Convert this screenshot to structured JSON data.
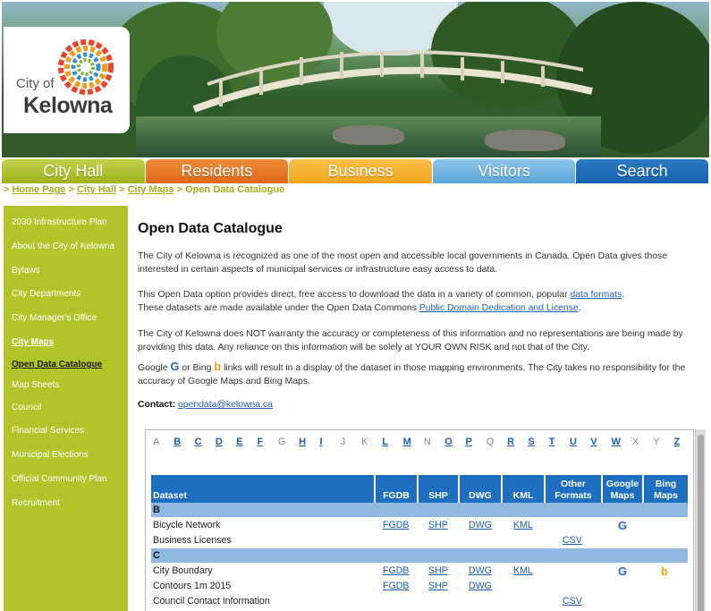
{
  "logo": {
    "line1": "City of",
    "line2": "Kelowna"
  },
  "nav": [
    "City Hall",
    "Residents",
    "Business",
    "Visitors",
    "Search"
  ],
  "breadcrumb": {
    "prefix": ">",
    "home": "Home Page",
    "city_hall": "City Hall",
    "city_maps": "City Maps",
    "current": "Open Data Catalogue",
    "sep": ">"
  },
  "sidebar": [
    "2030 Infrastructure Plan",
    "About the City of Kelowna",
    "Bylaws",
    "City Departments",
    "City Manager's Office",
    "City Maps",
    "Open Data Catalogue",
    "Map Sheets",
    "Council",
    "Financial Services",
    "Municipal Elections",
    "Official Community Plan",
    "Recruitment"
  ],
  "page": {
    "title": "Open Data Catalogue",
    "p1": "The City of Kelowna is recognized as one of the most open and accessible local governments in Canada. Open Data gives those interested in certain aspects of municipal services or infrastructure easy access to data.",
    "p2a": "This Open Data option provides direct, free access to download the data in a variety of common, popular",
    "p2_link1": "data formats",
    "p2b": "These datasets are made available under the Open Data Commons",
    "p2_link2": "Public Domain Dedication and License",
    "p3": "The City of Kelowna does NOT warranty the accuracy or completeness of this information and no representations are being made by providing this data. Any reliance on this information will be solely at YOUR OWN RISK and not that of the City.",
    "p4a": "Google",
    "p4b": "or Bing",
    "p4c": "links will result in a display of the dataset in those mapping environments. The City takes no responsibility for the accuracy of Google Maps and Bing Maps.",
    "contact_label": "Contact:",
    "contact_email": "opendata@kelowna.ca"
  },
  "alphabet": [
    {
      "l": "A",
      "link": false
    },
    {
      "l": "B",
      "link": true
    },
    {
      "l": "C",
      "link": true
    },
    {
      "l": "D",
      "link": true
    },
    {
      "l": "E",
      "link": true
    },
    {
      "l": "F",
      "link": true
    },
    {
      "l": "G",
      "link": false
    },
    {
      "l": "H",
      "link": true
    },
    {
      "l": "I",
      "link": true
    },
    {
      "l": "J",
      "link": false
    },
    {
      "l": "K",
      "link": false
    },
    {
      "l": "L",
      "link": true
    },
    {
      "l": "M",
      "link": true
    },
    {
      "l": "N",
      "link": false
    },
    {
      "l": "O",
      "link": true
    },
    {
      "l": "P",
      "link": true
    },
    {
      "l": "Q",
      "link": false
    },
    {
      "l": "R",
      "link": true
    },
    {
      "l": "S",
      "link": true
    },
    {
      "l": "T",
      "link": true
    },
    {
      "l": "U",
      "link": true
    },
    {
      "l": "V",
      "link": true
    },
    {
      "l": "W",
      "link": true
    },
    {
      "l": "X",
      "link": false
    },
    {
      "l": "Y",
      "link": false
    },
    {
      "l": "Z",
      "link": true
    }
  ],
  "table": {
    "headers": {
      "dataset": "Dataset",
      "fgdb": "FGDB",
      "shp": "SHP",
      "dwg": "DWG",
      "kml": "KML",
      "other1": "Other",
      "other2": "Formats",
      "google1": "Google",
      "google2": "Maps",
      "bing1": "Bing",
      "bing2": "Maps"
    },
    "groups": [
      {
        "letter": "B",
        "rows": [
          {
            "name": "Bicycle Network",
            "fgdb": "FGDB",
            "shp": "SHP",
            "dwg": "DWG",
            "kml": "KML",
            "other": "",
            "google": true,
            "bing": false
          },
          {
            "name": "Business Licenses",
            "fgdb": "",
            "shp": "",
            "dwg": "",
            "kml": "",
            "other": "CSV",
            "google": false,
            "bing": false
          }
        ]
      },
      {
        "letter": "C",
        "rows": [
          {
            "name": "City Boundary",
            "fgdb": "FGDB",
            "shp": "SHP",
            "dwg": "DWG",
            "kml": "KML",
            "other": "",
            "google": true,
            "bing": true
          },
          {
            "name": "Contours 1m 2015",
            "fgdb": "FGDB",
            "shp": "SHP",
            "dwg": "DWG",
            "kml": "",
            "other": "",
            "google": false,
            "bing": false
          },
          {
            "name": "Council Contact Information",
            "fgdb": "",
            "shp": "",
            "dwg": "",
            "kml": "",
            "other": "CSV",
            "google": false,
            "bing": false
          }
        ]
      }
    ]
  },
  "colors": {
    "nav_green": "#9fb21c",
    "nav_orange": "#dc6a16",
    "nav_yellow": "#f3a41b",
    "nav_lightblue": "#5aa6da",
    "nav_blue": "#1561ad",
    "header_blue": "#1f6fc0",
    "group_blue": "#8fb9e0",
    "link_blue": "#1f5fb0"
  }
}
